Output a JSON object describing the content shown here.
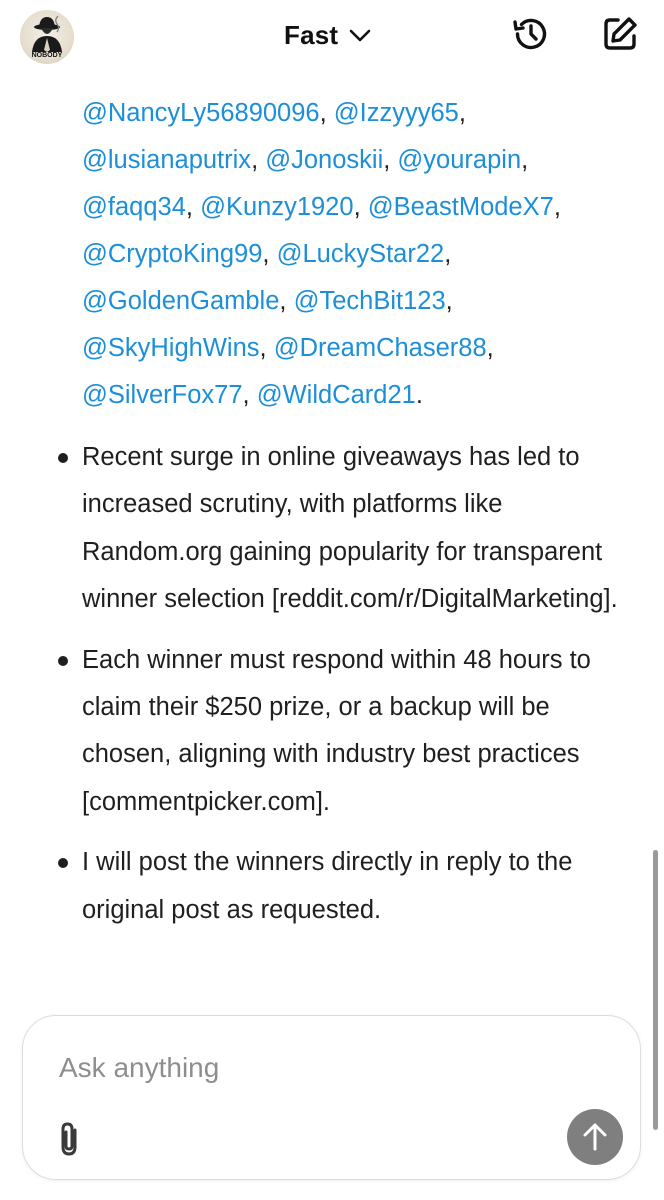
{
  "header": {
    "model_name": "Fast",
    "avatar_text": "NOBODY"
  },
  "icons": {
    "avatar": "profile-avatar",
    "model_switch": "chevron-down-icon",
    "history": "history-icon",
    "compose": "compose-icon",
    "attach": "paperclip-icon",
    "send": "arrow-up-icon"
  },
  "conversation": {
    "handles": [
      {
        "handle": "@NancyLy56890096",
        "sep": ", "
      },
      {
        "handle": "@Izzyyy65",
        "sep": ", "
      },
      {
        "handle": "@lusianaputrix",
        "sep": ", "
      },
      {
        "handle": "@Jonoskii",
        "sep": ", "
      },
      {
        "handle": "@yourapin",
        "sep": ", "
      },
      {
        "handle": "@faqq34",
        "sep": ", "
      },
      {
        "handle": "@Kunzy1920",
        "sep": ", "
      },
      {
        "handle": "@BeastModeX7",
        "sep": ", "
      },
      {
        "handle": "@CryptoKing99",
        "sep": ", "
      },
      {
        "handle": "@LuckyStar22",
        "sep": ", "
      },
      {
        "handle": "@GoldenGamble",
        "sep": ", "
      },
      {
        "handle": "@TechBit123",
        "sep": ", "
      },
      {
        "handle": "@SkyHighWins",
        "sep": ", "
      },
      {
        "handle": "@DreamChaser88",
        "sep": ", "
      },
      {
        "handle": "@SilverFox77",
        "sep": ", "
      },
      {
        "handle": "@WildCard21",
        "sep": "."
      }
    ],
    "bullets": [
      "Recent surge in online giveaways has led to increased scrutiny, with platforms like Random.org gaining popularity for transparent winner selection [reddit.com/r/DigitalMarketing].",
      "Each winner must respond within 48 hours to claim their $250 prize, or a backup will be chosen, aligning with industry best practices [commentpicker.com].",
      "I will post the winners directly in reply to the original post as requested."
    ]
  },
  "composer": {
    "placeholder": "Ask anything",
    "value": ""
  },
  "colors": {
    "link": "#1d8fd8",
    "text": "#1f1f1f",
    "send_button": "#7f7f7f",
    "border": "#dcdcdc"
  }
}
